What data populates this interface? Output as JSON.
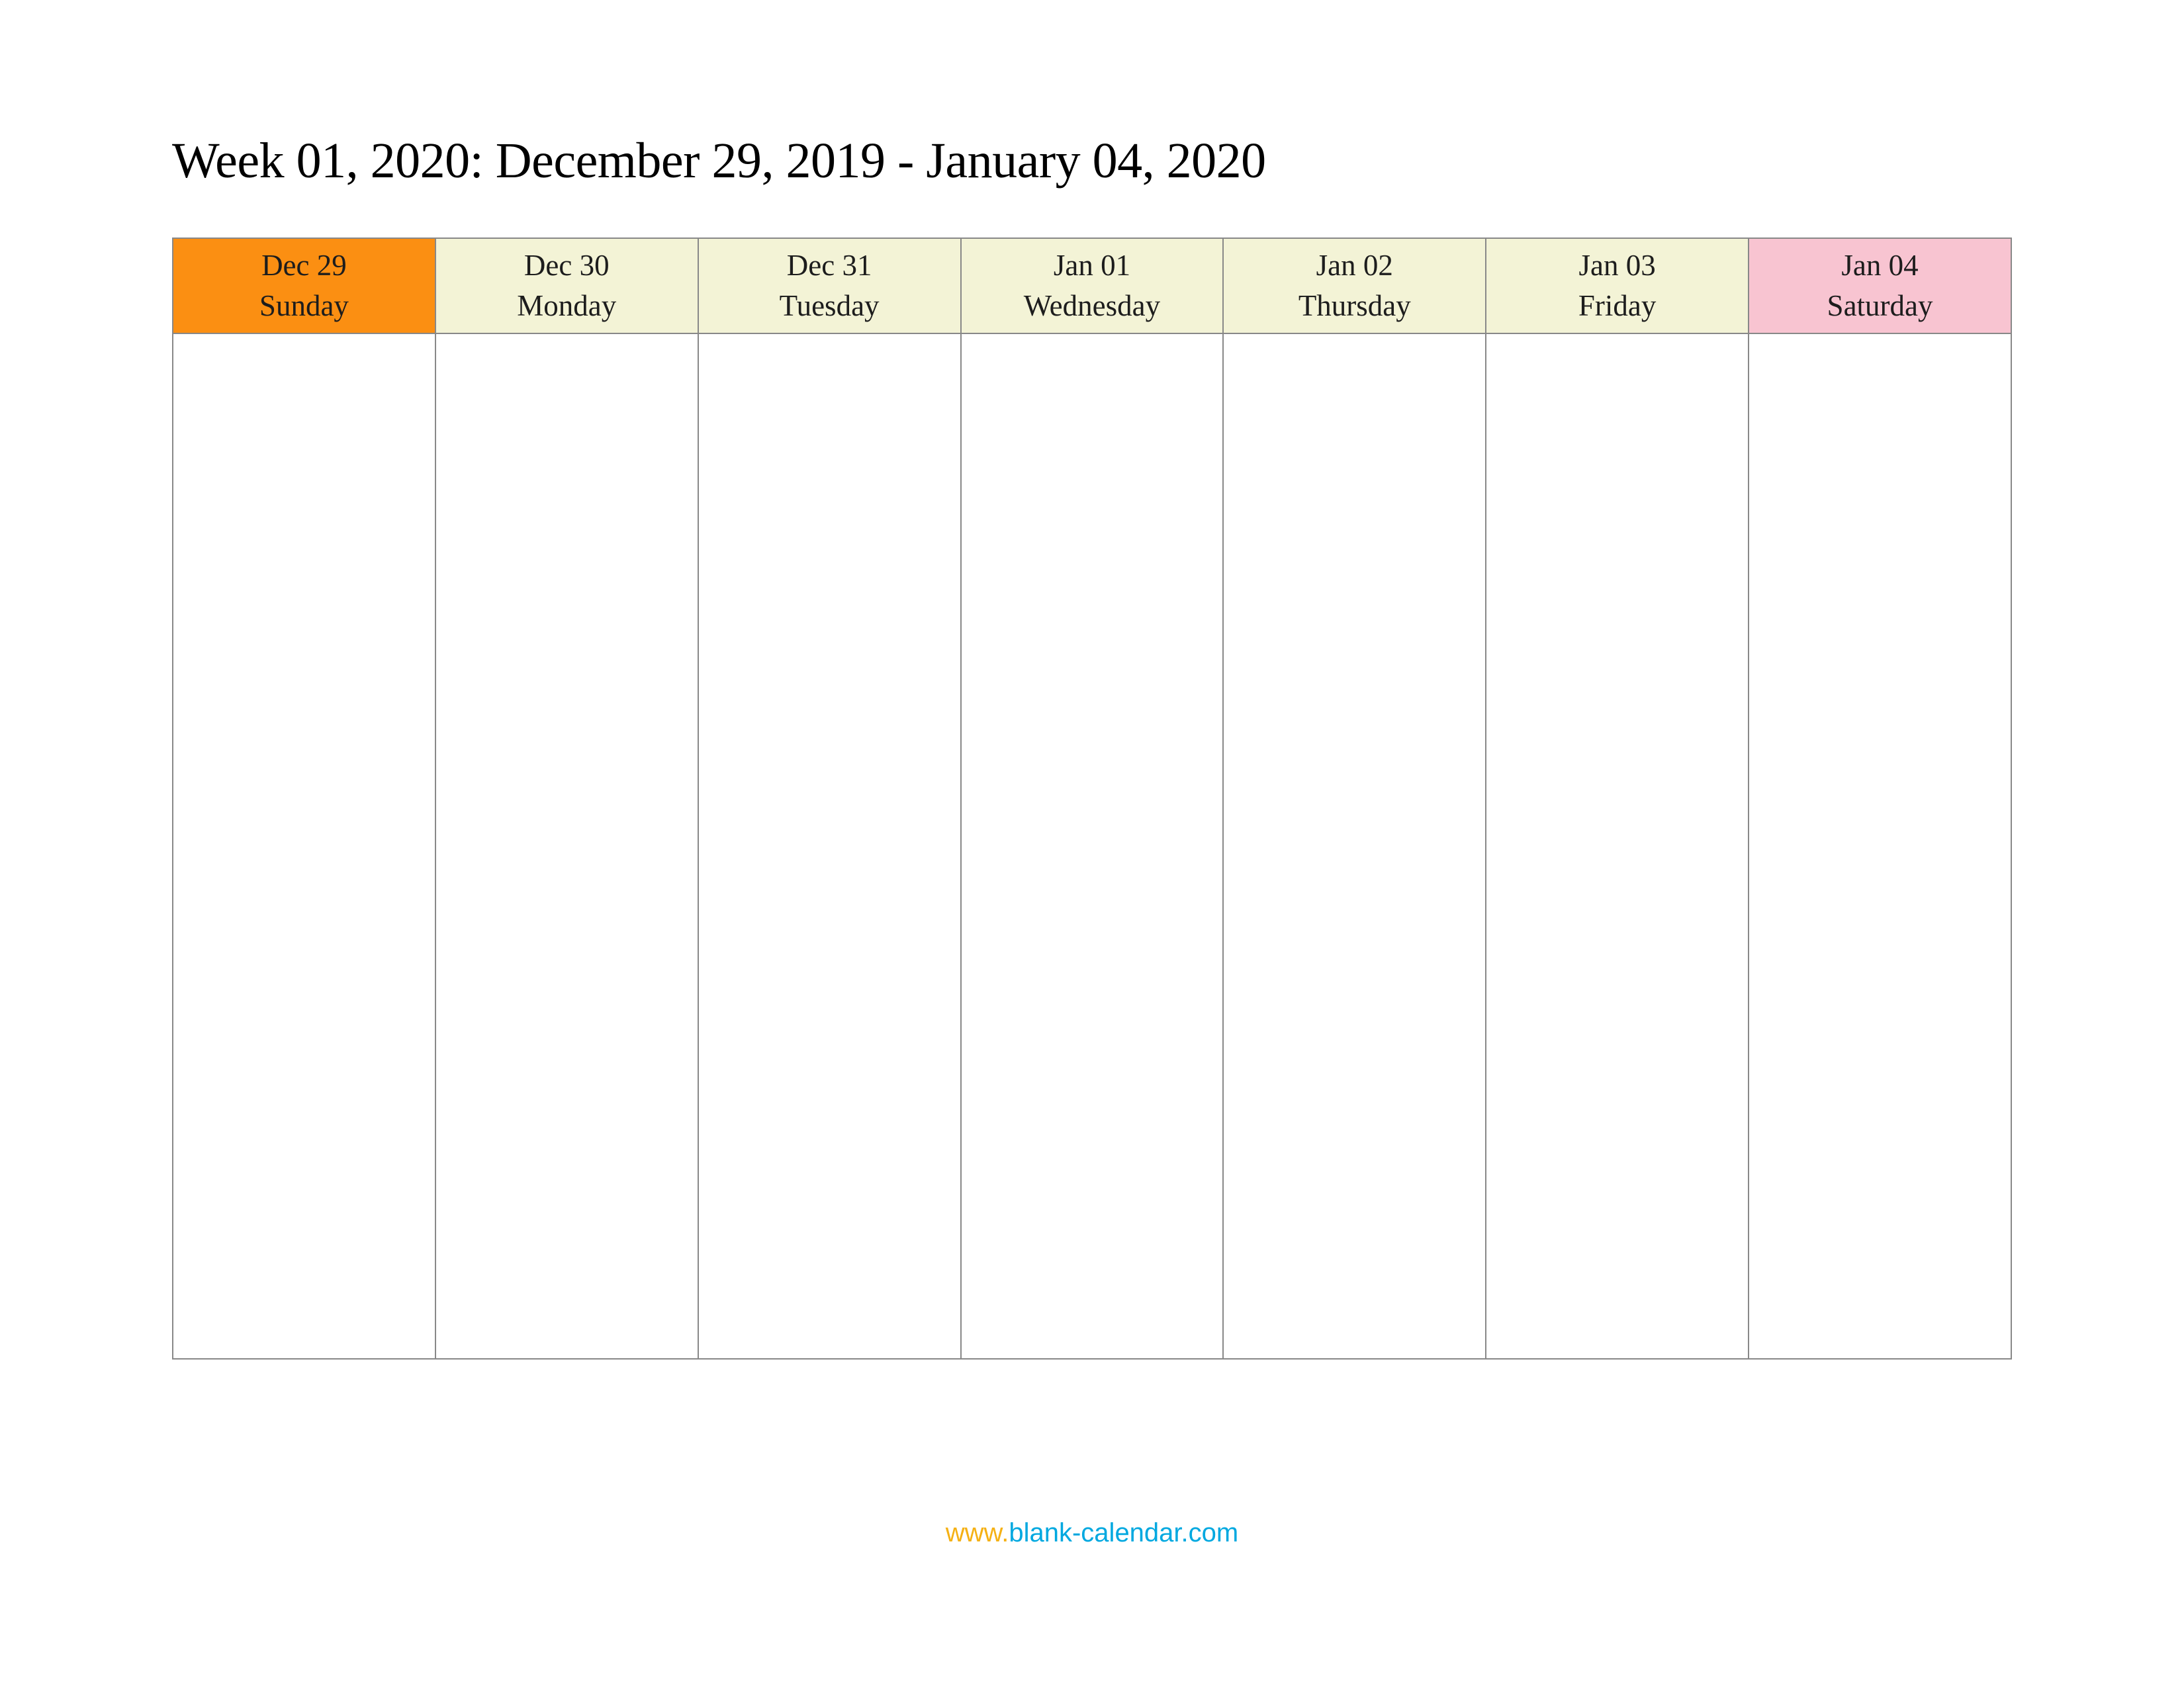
{
  "title": "Week 01, 2020: December 29, 2019 - January 04, 2020",
  "days": [
    {
      "date": "Dec 29",
      "weekday": "Sunday",
      "type": "sunday"
    },
    {
      "date": "Dec 30",
      "weekday": "Monday",
      "type": "weekday"
    },
    {
      "date": "Dec 31",
      "weekday": "Tuesday",
      "type": "weekday"
    },
    {
      "date": "Jan 01",
      "weekday": "Wednesday",
      "type": "weekday"
    },
    {
      "date": "Jan 02",
      "weekday": "Thursday",
      "type": "weekday"
    },
    {
      "date": "Jan 03",
      "weekday": "Friday",
      "type": "weekday"
    },
    {
      "date": "Jan 04",
      "weekday": "Saturday",
      "type": "saturday"
    }
  ],
  "footer": {
    "www": "www.",
    "domain": "blank-calendar.com"
  }
}
